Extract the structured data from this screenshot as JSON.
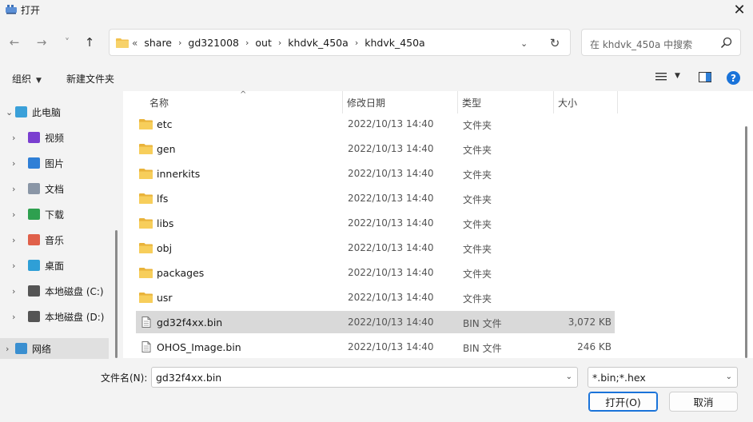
{
  "window": {
    "title": "打开",
    "close_label": "✕"
  },
  "nav": {
    "back_icon": "←",
    "forward_icon": "→",
    "recent_icon": "˅",
    "up_icon": "↑",
    "breadcrumb_lead": "«",
    "breadcrumbs": [
      "share",
      "gd321008",
      "out",
      "khdvk_450a",
      "khdvk_450a"
    ],
    "search_placeholder": "在 khdvk_450a 中搜索"
  },
  "toolbar": {
    "organize_label": "组织",
    "new_folder_label": "新建文件夹",
    "help_label": "?"
  },
  "sidebar": {
    "items": [
      {
        "label": "此电脑",
        "icon": "pc-icon",
        "color": "#3aa0d9",
        "indent": 0,
        "chevron": "⌄"
      },
      {
        "label": "视频",
        "icon": "video-icon",
        "color": "#7a3fd0",
        "indent": 1,
        "chevron": "›"
      },
      {
        "label": "图片",
        "icon": "pictures-icon",
        "color": "#2f7fd6",
        "indent": 1,
        "chevron": "›"
      },
      {
        "label": "文档",
        "icon": "documents-icon",
        "color": "#8a96a6",
        "indent": 1,
        "chevron": "›"
      },
      {
        "label": "下载",
        "icon": "download-icon",
        "color": "#2ea04f",
        "indent": 1,
        "chevron": "›"
      },
      {
        "label": "音乐",
        "icon": "music-icon",
        "color": "#e0604a",
        "indent": 1,
        "chevron": "›"
      },
      {
        "label": "桌面",
        "icon": "desktop-icon",
        "color": "#2f9fd6",
        "indent": 1,
        "chevron": "›"
      },
      {
        "label": "本地磁盘 (C:)",
        "icon": "drive-c-icon",
        "color": "#555555",
        "indent": 1,
        "chevron": "›"
      },
      {
        "label": "本地磁盘 (D:)",
        "icon": "drive-d-icon",
        "color": "#555555",
        "indent": 1,
        "chevron": "›"
      },
      {
        "label": "网络",
        "icon": "network-icon",
        "color": "#3a8fd0",
        "indent": 0,
        "chevron": "›",
        "selected": true
      }
    ]
  },
  "columns": {
    "name": "名称",
    "modified": "修改日期",
    "type": "类型",
    "size": "大小"
  },
  "files": [
    {
      "name": "etc",
      "date": "2022/10/13 14:40",
      "type": "文件夹",
      "size": "",
      "kind": "folder"
    },
    {
      "name": "gen",
      "date": "2022/10/13 14:40",
      "type": "文件夹",
      "size": "",
      "kind": "folder"
    },
    {
      "name": "innerkits",
      "date": "2022/10/13 14:40",
      "type": "文件夹",
      "size": "",
      "kind": "folder"
    },
    {
      "name": "lfs",
      "date": "2022/10/13 14:40",
      "type": "文件夹",
      "size": "",
      "kind": "folder"
    },
    {
      "name": "libs",
      "date": "2022/10/13 14:40",
      "type": "文件夹",
      "size": "",
      "kind": "folder"
    },
    {
      "name": "obj",
      "date": "2022/10/13 14:40",
      "type": "文件夹",
      "size": "",
      "kind": "folder"
    },
    {
      "name": "packages",
      "date": "2022/10/13 14:40",
      "type": "文件夹",
      "size": "",
      "kind": "folder"
    },
    {
      "name": "usr",
      "date": "2022/10/13 14:40",
      "type": "文件夹",
      "size": "",
      "kind": "folder"
    },
    {
      "name": "gd32f4xx.bin",
      "date": "2022/10/13 14:40",
      "type": "BIN 文件",
      "size": "3,072 KB",
      "kind": "file",
      "selected": true
    },
    {
      "name": "OHOS_Image.bin",
      "date": "2022/10/13 14:40",
      "type": "BIN 文件",
      "size": "246 KB",
      "kind": "file"
    }
  ],
  "footer": {
    "filename_label": "文件名(N):",
    "filename_value": "gd32f4xx.bin",
    "filter_value": "*.bin;*.hex",
    "open_label": "打开(O)",
    "cancel_label": "取消"
  },
  "colors": {
    "accent": "#1a73d9",
    "folder": "#f2c14e",
    "selected_row": "#d9d9d9"
  }
}
